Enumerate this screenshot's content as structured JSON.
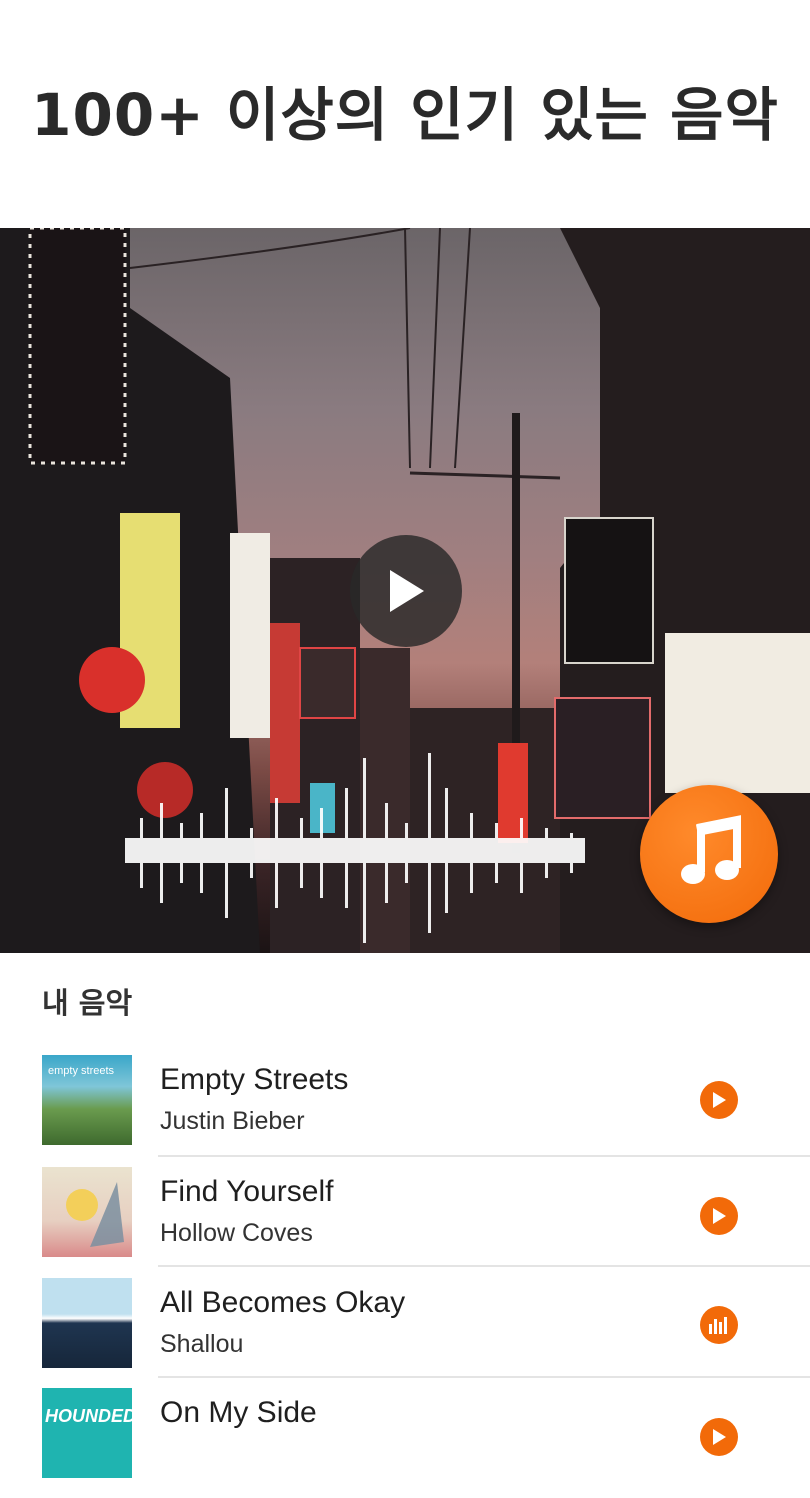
{
  "headline": "100+ 이상의 인기 있는 음악",
  "hero": {
    "play_icon": "play-icon",
    "music_icon": "music-note-icon",
    "accent_color": "#f26a09"
  },
  "section": {
    "title": "내 음악"
  },
  "tracks": [
    {
      "title": "Empty Streets",
      "artist": "Justin Bieber",
      "cover_text": "empty streets",
      "action_icon": "play-icon"
    },
    {
      "title": "Find Yourself",
      "artist": "Hollow  Coves",
      "action_icon": "play-icon"
    },
    {
      "title": "All Becomes Okay",
      "artist": "Shallou",
      "action_icon": "equalizer-icon"
    },
    {
      "title": "On My Side",
      "artist": "",
      "cover_text": "HOUNDED",
      "action_icon": "play-icon"
    }
  ]
}
